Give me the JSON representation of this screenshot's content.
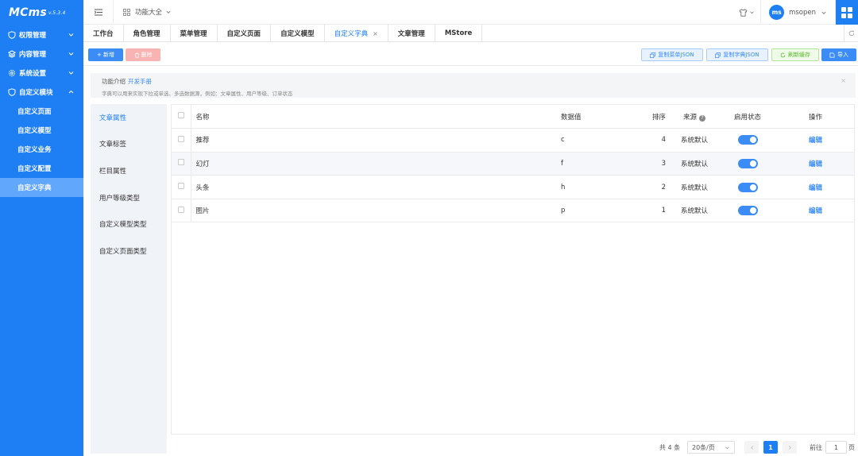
{
  "app": {
    "logo": "MCms",
    "version": "v.5.3.4"
  },
  "sidebar": {
    "menus": [
      {
        "label": "权限管理",
        "icon": "shield-icon"
      },
      {
        "label": "内容管理",
        "icon": "layers-icon"
      },
      {
        "label": "系统设置",
        "icon": "gear-icon"
      },
      {
        "label": "自定义模块",
        "icon": "module-icon"
      }
    ],
    "sub_items": [
      {
        "label": "自定义页面"
      },
      {
        "label": "自定义模型"
      },
      {
        "label": "自定义业务"
      },
      {
        "label": "自定义配置"
      },
      {
        "label": "自定义字典",
        "active": true
      }
    ]
  },
  "header": {
    "func_label": "功能大全",
    "username": "msopen",
    "avatar_text": "ms"
  },
  "tabs": [
    {
      "label": "工作台"
    },
    {
      "label": "角色管理"
    },
    {
      "label": "菜单管理"
    },
    {
      "label": "自定义页面"
    },
    {
      "label": "自定义模型"
    },
    {
      "label": "自定义字典",
      "active": true,
      "closable": "×"
    },
    {
      "label": "文章管理"
    },
    {
      "label": "MStore"
    }
  ],
  "toolbar": {
    "add": "+ 新增",
    "delete": "删除",
    "copy_menu_json": "复制菜单JSON",
    "copy_dict_json": "复制字典JSON",
    "refresh_cache": "刷新缓存",
    "import": "导入"
  },
  "notice": {
    "title": "功能介绍",
    "link": "开发手册",
    "text": "字典可以用来实现下拉或单选、多选数据源，例如：文章属性、用户等级、订单状态",
    "close": "×"
  },
  "categories": [
    {
      "label": "文章属性",
      "active": true
    },
    {
      "label": "文章标签"
    },
    {
      "label": "栏目属性"
    },
    {
      "label": "用户等级类型"
    },
    {
      "label": "自定义模型类型"
    },
    {
      "label": "自定义页面类型"
    }
  ],
  "table": {
    "headers": {
      "name": "名称",
      "value": "数据值",
      "sort": "排序",
      "source": "来源",
      "status": "启用状态",
      "ops": "操作"
    },
    "rows": [
      {
        "name": "推荐",
        "value": "c",
        "sort": "4",
        "source": "系统默认",
        "enabled": true,
        "op": "编辑"
      },
      {
        "name": "幻灯",
        "value": "f",
        "sort": "3",
        "source": "系统默认",
        "enabled": true,
        "op": "编辑"
      },
      {
        "name": "头条",
        "value": "h",
        "sort": "2",
        "source": "系统默认",
        "enabled": true,
        "op": "编辑"
      },
      {
        "name": "图片",
        "value": "p",
        "sort": "1",
        "source": "系统默认",
        "enabled": true,
        "op": "编辑"
      }
    ]
  },
  "pagination": {
    "total": "共 4 条",
    "page_size": "20条/页",
    "current": "1",
    "goto_label": "前往",
    "goto_value": "1",
    "page_suffix": "页"
  },
  "colors": {
    "primary": "#1e7ff5",
    "active_sub": "#61a7fc",
    "danger_light": "#f9b3b3",
    "success": "#5ab62b"
  }
}
